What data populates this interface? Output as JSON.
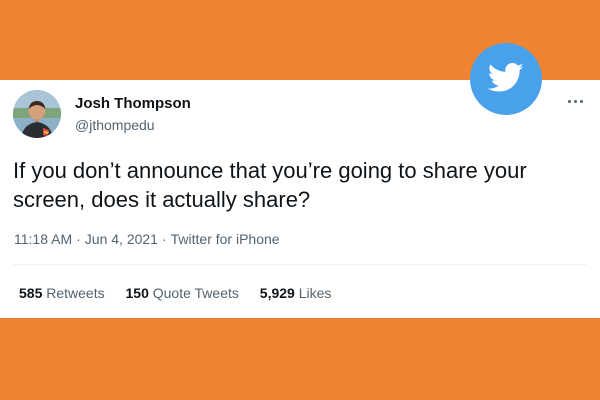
{
  "tweet": {
    "author_name": "Josh Thompson",
    "author_handle": "@jthompedu",
    "text": "If you don’t announce that you’re going to share your screen, does it actually share?",
    "time": "11:18 AM",
    "separator": "·",
    "date": "Jun 4, 2021",
    "source": "Twitter for iPhone",
    "more_label": "···"
  },
  "stats": {
    "retweets_count": "585",
    "retweets_label": "Retweets",
    "quotes_count": "150",
    "quotes_label": "Quote Tweets",
    "likes_count": "5,929",
    "likes_label": "Likes"
  },
  "icons": {
    "brand": "twitter-bird-icon",
    "more": "more-options-icon"
  },
  "colors": {
    "background": "#EE8431",
    "card": "#FFFFFF",
    "twitter_blue": "#4AA1EB",
    "primary_text": "#0F1419",
    "secondary_text": "#536471"
  }
}
